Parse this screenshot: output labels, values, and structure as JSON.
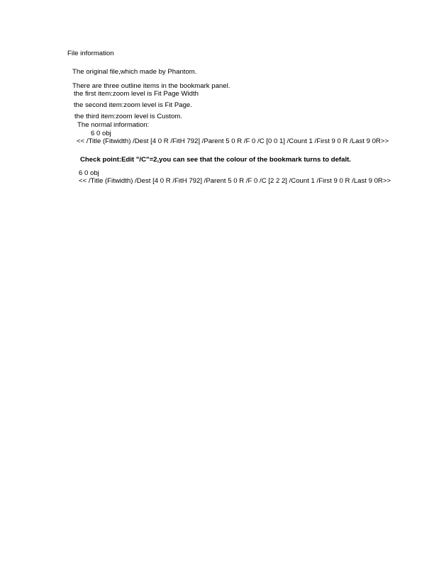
{
  "document": {
    "heading": "File information",
    "intro": "The original file,which made by Phantom.",
    "outline": {
      "summary": "There are three outline items in the bookmark panel.",
      "item1": "the first item:zoom level is Fit Page Width",
      "item2": "the second item:zoom level is Fit Page.",
      "item3": "the third item:zoom level is Custom."
    },
    "normal": {
      "label": "The normal information:",
      "obj": "6 0 obj",
      "dict": "<< /Title (Fitwidth) /Dest [4 0 R /FitH 792] /Parent 5 0 R /F 0 /C [0 0 1] /Count 1 /First 9 0 R /Last 9 0R>>"
    },
    "checkpoint": "Check point:Edit \"/C\"=2,you can see that the colour of the bookmark turns to defalt.",
    "edited": {
      "obj": "6 0 obj",
      "dict": "<< /Title (Fitwidth) /Dest [4 0 R /FitH 792] /Parent 5 0 R /F 0 /C [2 2 2] /Count 1 /First 9 0 R /Last 9 0R>>"
    }
  }
}
